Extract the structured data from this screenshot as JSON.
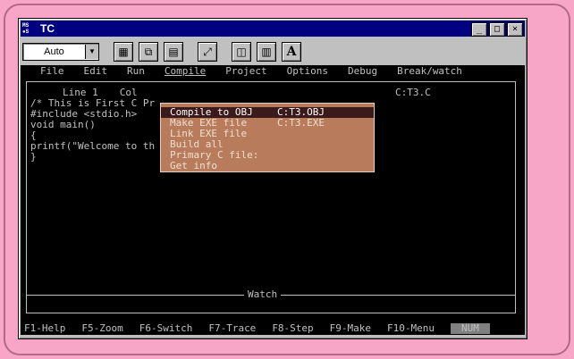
{
  "window": {
    "title": "TC",
    "icon_text": "MS—DOS",
    "controls": [
      "minimize-icon",
      "maximize-icon",
      "close-icon"
    ]
  },
  "toolbar": {
    "font_combo": "Auto",
    "buttons": [
      "mark-icon",
      "copy-icon",
      "paste-icon",
      "fullscreen-icon",
      "properties-icon",
      "background-icon",
      "font-icon"
    ],
    "font_button_label": "A"
  },
  "menubar": {
    "items": [
      "File",
      "Edit",
      "Run",
      "Compile",
      "Project",
      "Options",
      "Debug",
      "Break/watch"
    ],
    "active": "Compile"
  },
  "editor": {
    "line_label": "Line 1",
    "col_label": "Col",
    "file_label": "C:T3.C",
    "code_lines": [
      "/* This is First C Pr",
      "#include <stdio.h>",
      "void main()",
      "{",
      "printf(\"Welcome to th",
      "}"
    ]
  },
  "compile_menu": {
    "items": [
      {
        "label": "Compile to OBJ",
        "value": "C:T3.OBJ",
        "selected": true
      },
      {
        "label": "Make EXE file",
        "value": "C:T3.EXE",
        "selected": false
      },
      {
        "label": "Link EXE file",
        "value": "",
        "selected": false
      },
      {
        "label": "Build all",
        "value": "",
        "selected": false
      },
      {
        "label": "Primary C file:",
        "value": "",
        "selected": false
      },
      {
        "label": "Get info",
        "value": "",
        "selected": false
      }
    ]
  },
  "watch": {
    "label": "Watch"
  },
  "statusbar": {
    "keys": [
      "F1-Help",
      "F5-Zoom",
      "F6-Switch",
      "F7-Trace",
      "F8-Step",
      "F9-Make",
      "F10-Menu"
    ],
    "badge": "NUM"
  },
  "colors": {
    "page_background": "#f7a6c8",
    "title_bar": "#000080",
    "menu_background": "#b87c5c",
    "menu_selected": "#3a1a1a",
    "terminal": "#000000"
  }
}
